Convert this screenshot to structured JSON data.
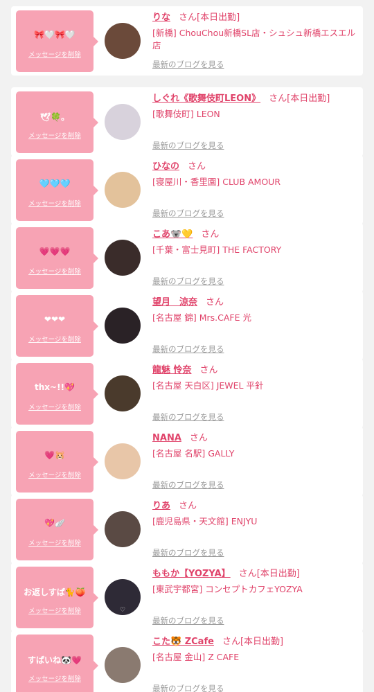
{
  "cards": [
    {
      "message": "🎀🤍🎀🤍",
      "delete_label": "メッセージを削除",
      "name": "りな",
      "san": "さん",
      "work_status": "[本日出勤]",
      "shop": "[新橋] ChouChou新橋SL店・シュシュ新橋エスエル店",
      "blog_label": "最新のブログを見る",
      "avatar_color": "#6b4a3a"
    },
    {
      "message": "🕊🍀。",
      "delete_label": "メッセージを削除",
      "name": "しぐれ《歌舞伎町LEON》",
      "san": "さん",
      "work_status": "[本日出勤]",
      "shop": "[歌舞伎町] LEON",
      "blog_label": "最新のブログを見る",
      "avatar_color": "#d8d2dc"
    },
    {
      "message": "🩵🩵🩵",
      "delete_label": "メッセージを削除",
      "name": "ひなの",
      "san": "さん",
      "work_status": "",
      "shop": "[寝屋川・香里園] CLUB AMOUR",
      "blog_label": "最新のブログを見る",
      "avatar_color": "#e3c29b"
    },
    {
      "message": "💗💗💗",
      "delete_label": "メッセージを削除",
      "name": "こあ🐨💛",
      "san": "さん",
      "work_status": "",
      "shop": "[千葉・富士見町] THE FACTORY",
      "blog_label": "最新のブログを見る",
      "avatar_color": "#3a2c2a"
    },
    {
      "message": "❤︎❤︎❤︎",
      "delete_label": "メッセージを削除",
      "name": "望月　涼奈",
      "san": "さん",
      "work_status": "",
      "shop": "[名古屋 錦] Mrs.CAFE 光",
      "blog_label": "最新のブログを見る",
      "avatar_color": "#2a2226"
    },
    {
      "message": "thx~!!💖",
      "delete_label": "メッセージを削除",
      "name": "龍魅 怜奈",
      "san": "さん",
      "work_status": "",
      "shop": "[名古屋 天白区] JEWEL 平針",
      "blog_label": "最新のブログを見る",
      "avatar_color": "#4a3a2c"
    },
    {
      "message": "💗🐹",
      "delete_label": "メッセージを削除",
      "name": "NANA",
      "san": "さん",
      "work_status": "",
      "shop": "[名古屋 名駅] GALLY",
      "blog_label": "最新のブログを見る",
      "avatar_color": "#e8c6a8"
    },
    {
      "message": "💖🪽",
      "delete_label": "メッセージを削除",
      "name": "りあ",
      "san": "さん",
      "work_status": "",
      "shop": "[鹿児島県・天文館] ENJYU",
      "blog_label": "最新のブログを見る",
      "avatar_color": "#5a4a44"
    },
    {
      "message": "お返しすぱ🐈🍑",
      "delete_label": "メッセージを削除",
      "name": "ももか【YOZYA】",
      "san": "さん",
      "work_status": "[本日出勤]",
      "shop": "[東武宇都宮] コンセプトカフェYOZYA",
      "blog_label": "最新のブログを見る",
      "avatar_color": "#2e2a36",
      "avatar_text": "♡"
    },
    {
      "message": "すぱいね🐼💗",
      "delete_label": "メッセージを削除",
      "name": "こた🐯 ZCafe",
      "san": "さん",
      "work_status": "[本日出勤]",
      "shop": "[名古屋 金山] Z CAFE",
      "blog_label": "最新のブログを見る",
      "avatar_color": "#8a7a70"
    }
  ]
}
